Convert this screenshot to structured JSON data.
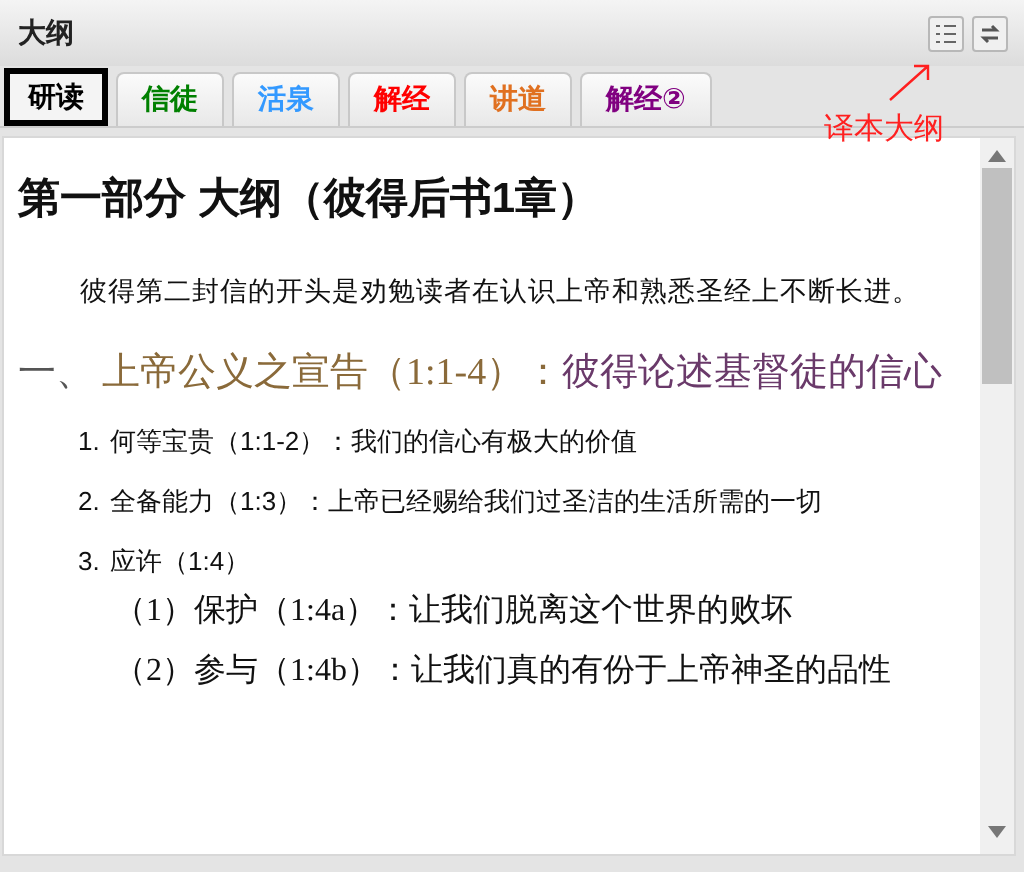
{
  "panel": {
    "title": "大纲"
  },
  "tabs": [
    {
      "label": "研读",
      "selected": true,
      "color": "#000000"
    },
    {
      "label": "信徒",
      "selected": false,
      "color": "#008000"
    },
    {
      "label": "活泉",
      "selected": false,
      "color": "#3399ff"
    },
    {
      "label": "解经",
      "selected": false,
      "color": "#ff0000"
    },
    {
      "label": "讲道",
      "selected": false,
      "color": "#e07020"
    },
    {
      "label": "解经②",
      "selected": false,
      "color": "#800080"
    }
  ],
  "annotation": "译本大纲",
  "content": {
    "heading": "第一部分 大纲（彼得后书1章）",
    "intro": "彼得第二封信的开头是劝勉读者在认识上帝和熟悉圣经上不断长进。",
    "section": {
      "number": "一、",
      "title": "上帝公义之宣告（1:1-4）：",
      "subtitle": "彼得论述基督徒的信心"
    },
    "items": [
      {
        "number": "1.",
        "text": "何等宝贵（1:1-2）：我们的信心有极大的价值"
      },
      {
        "number": "2.",
        "text": "全备能力（1:3）：上帝已经赐给我们过圣洁的生活所需的一切"
      },
      {
        "number": "3.",
        "text": "应许（1:4）",
        "children": [
          {
            "text": "（1）保护（1:4a）：让我们脱离这个世界的败坏"
          },
          {
            "text": "（2）参与（1:4b）：让我们真的有份于上帝神圣的品性"
          }
        ]
      }
    ]
  }
}
